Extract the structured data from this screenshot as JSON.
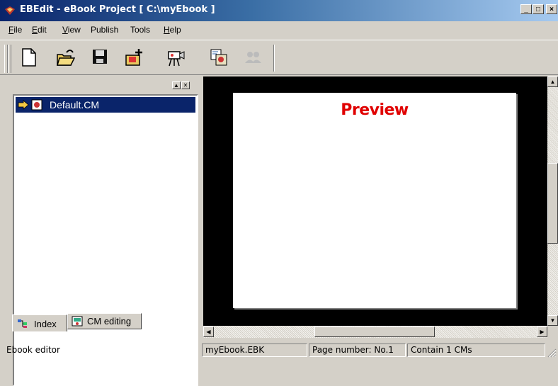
{
  "window": {
    "title": "EBEdit - eBook Project [ C:\\myEbook ]",
    "title_color": "#0a246a"
  },
  "menu": [
    {
      "mn": "F",
      "rest": "ile"
    },
    {
      "mn": "E",
      "rest": "dit"
    },
    {
      "mn": "V",
      "rest": "iew"
    },
    {
      "mn": "",
      "rest": "Publish"
    },
    {
      "mn": "",
      "rest": "Tools"
    },
    {
      "mn": "H",
      "rest": "elp"
    }
  ],
  "toolbar": {
    "buttons": [
      "new-icon",
      "open-icon",
      "save-icon",
      "add-page-icon",
      "preview-camera-icon",
      "publish-icon",
      "users-icon"
    ]
  },
  "left_panel": {
    "tree_items": [
      {
        "label": "Default.CM",
        "selected": true
      }
    ],
    "tabs": [
      {
        "label": "Index"
      },
      {
        "label": "CM editing"
      }
    ]
  },
  "preview": {
    "title": "Preview",
    "title_color": "#e00000"
  },
  "status": {
    "left": "Ebook editor",
    "file": "myEbook.EBK",
    "page": "Page number: No.1",
    "count": "Contain 1 CMs"
  }
}
